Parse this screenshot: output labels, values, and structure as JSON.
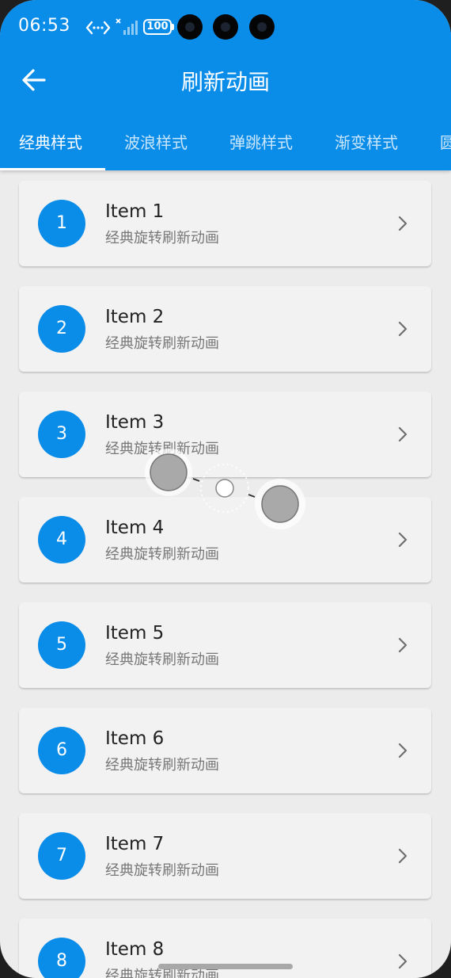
{
  "status": {
    "time": "06:53",
    "battery": "100"
  },
  "header": {
    "title": "刷新动画"
  },
  "tabs": [
    "经典样式",
    "波浪样式",
    "弹跳样式",
    "渐变样式",
    "圆"
  ],
  "items": [
    {
      "number": "1",
      "title": "Item 1",
      "subtitle": "经典旋转刷新动画"
    },
    {
      "number": "2",
      "title": "Item 2",
      "subtitle": "经典旋转刷新动画"
    },
    {
      "number": "3",
      "title": "Item 3",
      "subtitle": "经典旋转刷新动画"
    },
    {
      "number": "4",
      "title": "Item 4",
      "subtitle": "经典旋转刷新动画"
    },
    {
      "number": "5",
      "title": "Item 5",
      "subtitle": "经典旋转刷新动画"
    },
    {
      "number": "6",
      "title": "Item 6",
      "subtitle": "经典旋转刷新动画"
    },
    {
      "number": "7",
      "title": "Item 7",
      "subtitle": "经典旋转刷新动画"
    },
    {
      "number": "8",
      "title": "Item 8",
      "subtitle": "经典旋转刷新动画"
    }
  ],
  "colors": {
    "primary": "#0a8ce9",
    "card": "#f2f2f2",
    "background": "#ececec"
  }
}
